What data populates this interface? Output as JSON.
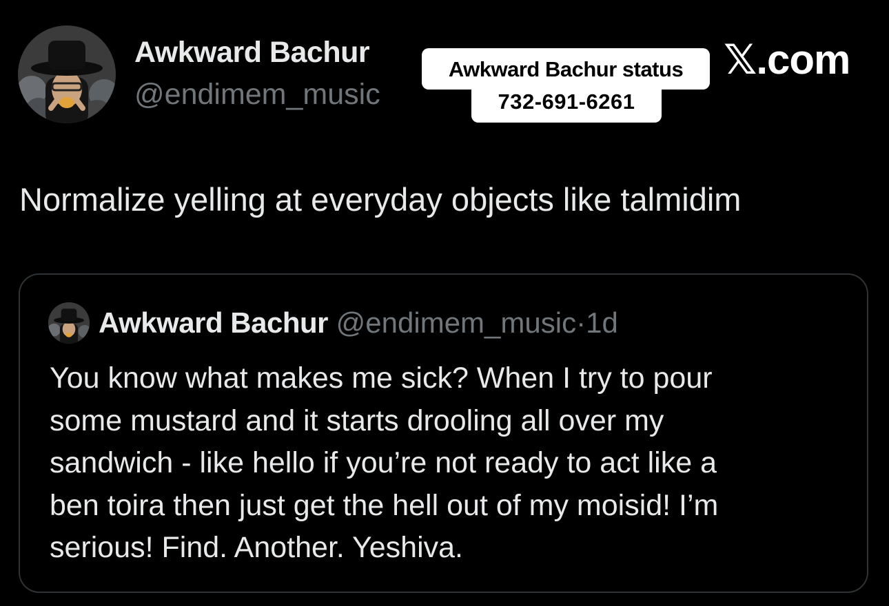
{
  "tweet": {
    "author": {
      "display_name": "Awkward Bachur",
      "handle": "@endimem_music"
    },
    "text": "Normalize yelling at everyday objects like talmidim"
  },
  "overlay": {
    "sticker_line1": "Awkward Bachur status",
    "sticker_line2": "732-691-6261",
    "site_label": "𝕏.com"
  },
  "quoted_tweet": {
    "display_name": "Awkward Bachur",
    "handle": "@endimem_music",
    "separator": "·",
    "time": "1d",
    "lines": [
      "You know what makes me sick? When I try to pour",
      "some mustard and it starts drooling all over my",
      "sandwich - like hello if you’re not ready to act like a",
      "ben toira then just get the hell out of my moisid! I’m",
      "serious! Find. Another. Yeshiva."
    ]
  },
  "colors": {
    "background": "#000000",
    "primary_text": "#e7e9ea",
    "secondary_text": "#71767b",
    "border": "#2f3336",
    "sticker_bg": "#ffffff"
  },
  "icons": {
    "avatar": "profile-photo-man-black-hat",
    "site_logo": "x-logo"
  }
}
